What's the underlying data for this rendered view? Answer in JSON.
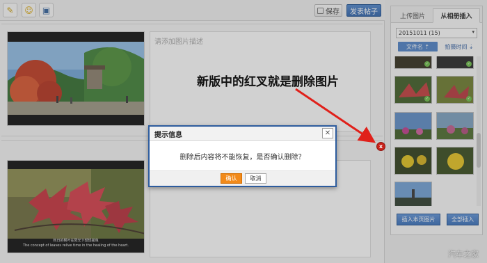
{
  "toolbar": {
    "icons": [
      "magic-wand-icon",
      "emoji-icon",
      "media-icon"
    ],
    "save_label": "保存",
    "publish_label": "发表帖子"
  },
  "editor": {
    "description_placeholder": "请添加图片描述",
    "photo2_caption_cn": "秋日的枫叶在阳光下轻轻摇曳",
    "photo2_caption_en": "The concept of leaves relive time in the healing of the heart."
  },
  "delete_photo_glyph": "x",
  "annotation": {
    "text": "新版中的红叉就是删除图片",
    "color": "#e0201a"
  },
  "panel": {
    "tabs": [
      "上传图片",
      "从相册插入"
    ],
    "album_select_value": "20151011 (15)",
    "sort_filename_label": "文件名 ⇡",
    "sort_time_label": "拍摄时间 ⇣",
    "insert_page_label": "插入本页图片",
    "insert_all_label": "全部插入"
  },
  "dialog": {
    "title": "提示信息",
    "close_glyph": "✕",
    "message": "删除后内容将不能恢复，是否确认删除？",
    "ok_label": "确认",
    "cancel_label": "取消"
  },
  "watermark": "汽车之家",
  "colors": {
    "accent_blue": "#2d5c9e",
    "confirm_orange": "#f28a1a",
    "delete_red": "#c8211a"
  }
}
